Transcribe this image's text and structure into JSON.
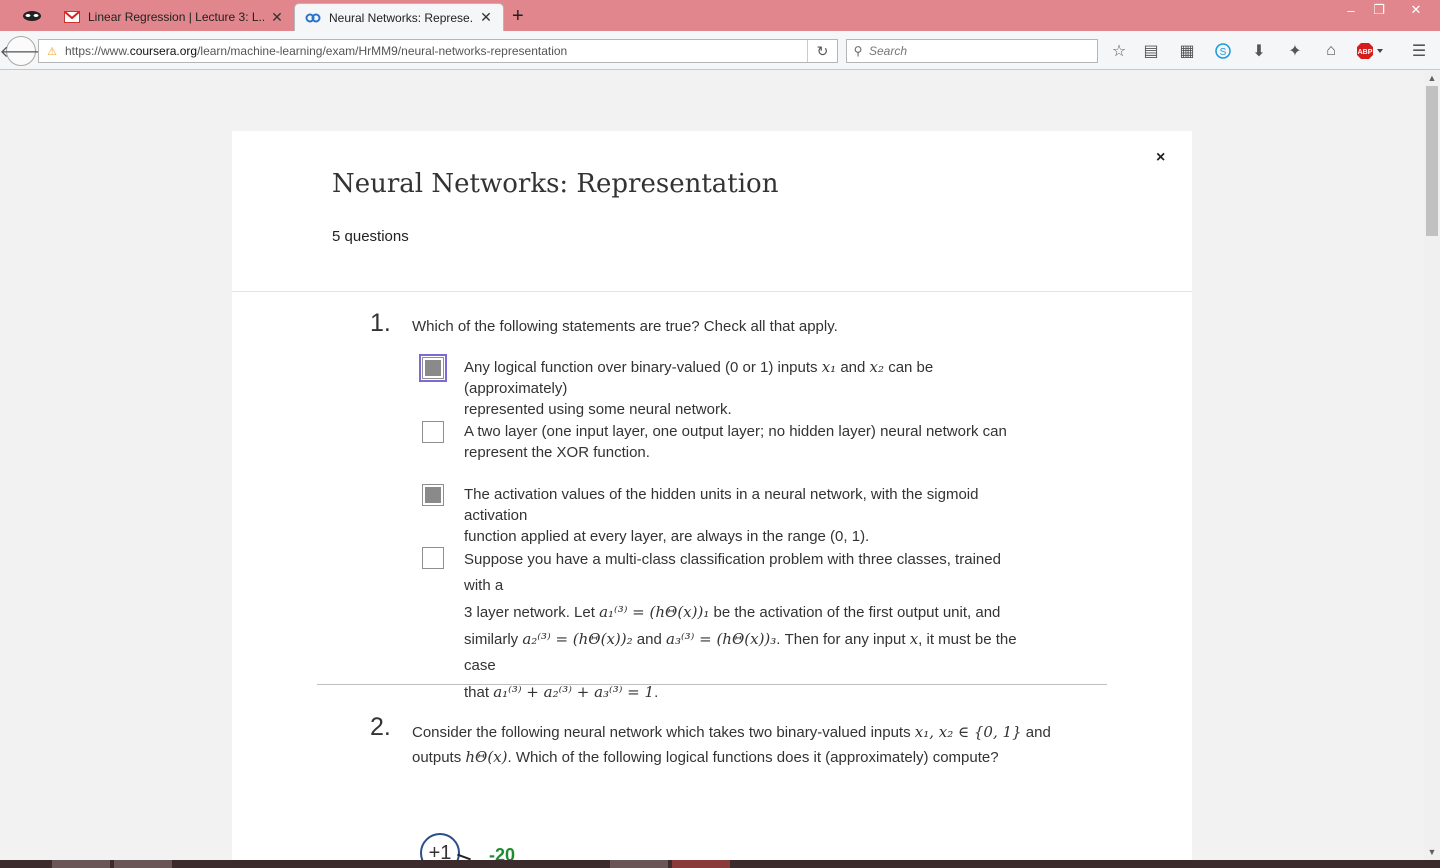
{
  "browser": {
    "tabs": [
      {
        "title": "Linear Regression | Lecture 3: L...",
        "favicon": "gmail-icon",
        "active": false
      },
      {
        "title": "Neural Networks: Represe...",
        "favicon": "coursera-icon",
        "active": true
      }
    ],
    "new_tab": "+",
    "url": {
      "prefix": "https://www.",
      "domain": "coursera.org",
      "path": "/learn/machine-learning/exam/HrMM9/neural-networks-representation"
    },
    "search_placeholder": "Search",
    "window_controls": {
      "minimize": "–",
      "restore": "❐",
      "close": "✕"
    },
    "toolbar_icons": [
      "star-icon",
      "reading-list-icon",
      "grid-icon",
      "skype-icon",
      "download-icon",
      "extension-icon",
      "home-icon",
      "adblock-icon",
      "menu-icon"
    ],
    "adblock_label": "ABP"
  },
  "quiz": {
    "close": "×",
    "title": "Neural Networks: Representation",
    "count": "5 questions",
    "questions": [
      {
        "number": "1.",
        "prompt": "Which of the following statements are true? Check all that apply.",
        "options": [
          {
            "checked": true,
            "line1_a": "Any logical function over binary-valued (0 or 1) inputs ",
            "line1_b": " and ",
            "line1_c": " can be (approximately)",
            "line2": "represented using some neural network.",
            "math_x1": "x₁",
            "math_x2": "x₂"
          },
          {
            "checked": false,
            "line1": "A two layer (one input layer, one output layer; no hidden layer) neural network can",
            "line2": "represent the XOR function."
          },
          {
            "checked": true,
            "line1": "The activation values of the hidden units in a neural network, with the sigmoid activation",
            "line2": "function applied at every layer, are always in the range (0, 1)."
          },
          {
            "checked": false,
            "line1": "Suppose you have a multi-class classification problem with three classes, trained with a",
            "line2_a": "3 layer network. Let ",
            "line2_math": "a₁⁽³⁾ = (hΘ(x))₁",
            "line2_b": " be the activation of the first output unit, and",
            "line3_a": "similarly ",
            "line3_math1": "a₂⁽³⁾ = (hΘ(x))₂",
            "line3_b": " and ",
            "line3_math2": "a₃⁽³⁾ = (hΘ(x))₃",
            "line3_c": ". Then for any input ",
            "line3_math3": "x",
            "line3_d": ", it must be the case",
            "line4_a": "that ",
            "line4_math": "a₁⁽³⁾ + a₂⁽³⁾ + a₃⁽³⁾ = 1",
            "line4_b": "."
          }
        ]
      },
      {
        "number": "2.",
        "line1_a": "Consider the following neural network which takes two binary-valued inputs ",
        "line1_math": "x₁, x₂ ∈ {0, 1}",
        "line1_b": " and",
        "line2_a": "outputs ",
        "line2_math": "hΘ(x)",
        "line2_b": ". Which of the following logical functions does it (approximately) compute?",
        "diagram": {
          "bias_label": "+1",
          "weight_label": "-20",
          "weight_color": "#1e8c2f"
        }
      }
    ]
  },
  "colors": {
    "tabbar": "#e0868c",
    "checkbox_focus": "#7b69d6",
    "checked_fill": "#8a8a8a"
  }
}
